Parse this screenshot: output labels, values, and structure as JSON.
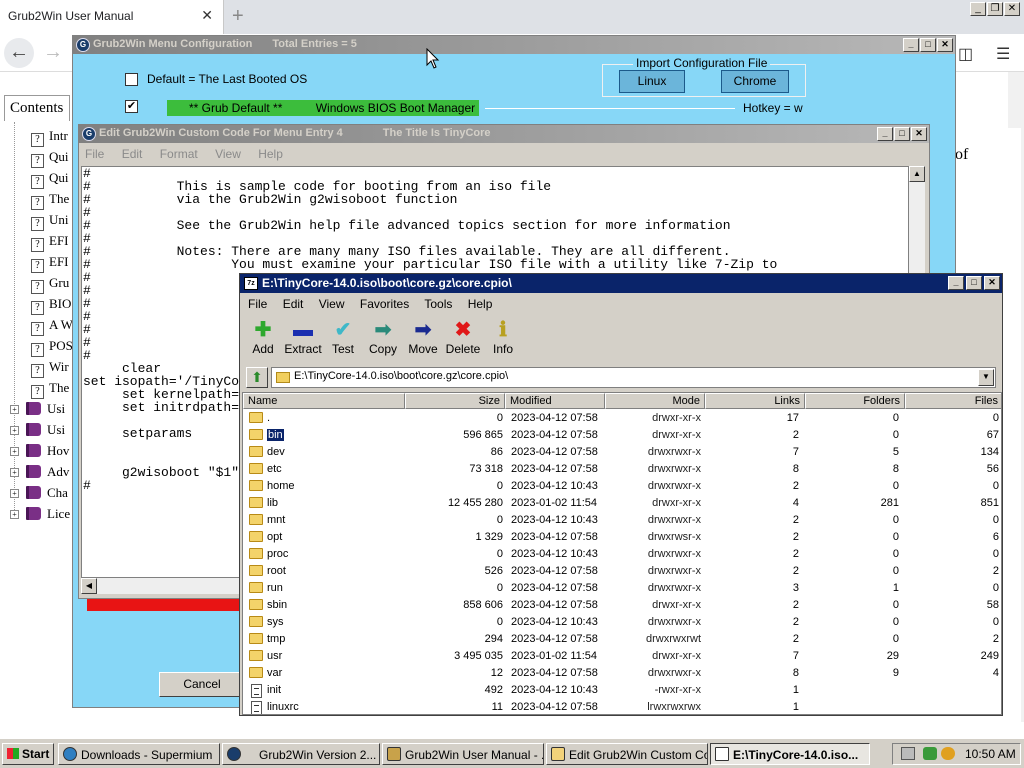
{
  "browser": {
    "tab_title": "Grub2Win User Manual",
    "tab_close": "✕",
    "new_tab": "+",
    "sys_buttons": [
      "_",
      "❐",
      "✕"
    ],
    "contents_tab": "Contents",
    "toc_items": [
      {
        "type": "page",
        "label": "Intr"
      },
      {
        "type": "page",
        "label": "Qui"
      },
      {
        "type": "page",
        "label": "Qui"
      },
      {
        "type": "page",
        "label": "The"
      },
      {
        "type": "page",
        "label": "Uni"
      },
      {
        "type": "page",
        "label": "EFI"
      },
      {
        "type": "page",
        "label": "EFI"
      },
      {
        "type": "page",
        "label": "Gru"
      },
      {
        "type": "page",
        "label": "BIO"
      },
      {
        "type": "page",
        "label": "A W"
      },
      {
        "type": "page",
        "label": "POS"
      },
      {
        "type": "page",
        "label": "Wir"
      },
      {
        "type": "page",
        "label": "The"
      },
      {
        "type": "book",
        "label": "Usi"
      },
      {
        "type": "book",
        "label": "Usi"
      },
      {
        "type": "book",
        "label": "Hov"
      },
      {
        "type": "book",
        "label": "Adv"
      },
      {
        "type": "book",
        "label": "Cha"
      },
      {
        "type": "book",
        "label": "Lice"
      }
    ],
    "right_text": "of"
  },
  "menu_config": {
    "title": "Grub2Win Menu Configuration",
    "total_entries": "Total Entries = 5",
    "default_label": "Default = The Last Booted OS",
    "default_checked": false,
    "entry_checked": true,
    "import_legend": "Import Configuration File",
    "import_buttons": [
      "Linux",
      "Chrome"
    ],
    "grub_default": "** Grub Default **",
    "entry_name": "Windows BIOS Boot Manager",
    "hotkey": "Hotkey = w",
    "cancel": "Cancel"
  },
  "edit_window": {
    "title": "Edit Grub2Win Custom Code For Menu Entry 4",
    "title_suffix": "The Title Is TinyCore",
    "menu": [
      "File",
      "Edit",
      "Format",
      "View",
      "Help"
    ],
    "code": "#\n#           This is sample code for booting from an iso file\n#           via the Grub2Win g2wisoboot function\n#\n#           See the Grub2Win help file advanced topics section for more information\n#\n#           Notes: There are many many ISO files available. They are all different.\n#                  You must examine your particular ISO file with a utility like 7-Zip to\n#\n#\n#\n#\n#\n#\n#\n     clear\nset isopath='/TinyCo\n     set kernelpath=\n     set initrdpath=\n\n     setparams\n\n\n     g2wisoboot \"$1\"\n#"
  },
  "zip_window": {
    "title": "E:\\TinyCore-14.0.iso\\boot\\core.gz\\core.cpio\\",
    "menu": [
      "File",
      "Edit",
      "View",
      "Favorites",
      "Tools",
      "Help"
    ],
    "toolbar": [
      {
        "label": "Add",
        "icon": "plus-icon",
        "glyph": "✚",
        "color": "#2ea82e"
      },
      {
        "label": "Extract",
        "icon": "minus-icon",
        "glyph": "▬",
        "color": "#1a2fb0"
      },
      {
        "label": "Test",
        "icon": "check-icon",
        "glyph": "✔",
        "color": "#3fb8c8"
      },
      {
        "label": "Copy",
        "icon": "copy-arrow-icon",
        "glyph": "➡",
        "color": "#2a8a7a"
      },
      {
        "label": "Move",
        "icon": "move-arrow-icon",
        "glyph": "➡",
        "color": "#1a2a90"
      },
      {
        "label": "Delete",
        "icon": "delete-x-icon",
        "glyph": "✖",
        "color": "#e01818"
      },
      {
        "label": "Info",
        "icon": "info-icon",
        "glyph": "ℹ",
        "color": "#b8a020"
      }
    ],
    "address": "E:\\TinyCore-14.0.iso\\boot\\core.gz\\core.cpio\\",
    "columns": [
      "Name",
      "Size",
      "Modified",
      "Mode",
      "Links",
      "Folders",
      "Files"
    ],
    "rows": [
      {
        "kind": "folder",
        "name": ".",
        "size": "0",
        "modified": "2023-04-12 07:58",
        "mode": "drwxr-xr-x",
        "links": "17",
        "folders": "0",
        "files": "0"
      },
      {
        "kind": "folder",
        "name": "bin",
        "size": "596 865",
        "modified": "2023-04-12 07:58",
        "mode": "drwxr-xr-x",
        "links": "2",
        "folders": "0",
        "files": "67",
        "selected": true
      },
      {
        "kind": "folder",
        "name": "dev",
        "size": "86",
        "modified": "2023-04-12 07:58",
        "mode": "drwxrwxr-x",
        "links": "7",
        "folders": "5",
        "files": "134"
      },
      {
        "kind": "folder",
        "name": "etc",
        "size": "73 318",
        "modified": "2023-04-12 07:58",
        "mode": "drwxrwxr-x",
        "links": "8",
        "folders": "8",
        "files": "56"
      },
      {
        "kind": "folder",
        "name": "home",
        "size": "0",
        "modified": "2023-04-12 10:43",
        "mode": "drwxrwxr-x",
        "links": "2",
        "folders": "0",
        "files": "0"
      },
      {
        "kind": "folder",
        "name": "lib",
        "size": "12 455 280",
        "modified": "2023-01-02 11:54",
        "mode": "drwxr-xr-x",
        "links": "4",
        "folders": "281",
        "files": "851"
      },
      {
        "kind": "folder",
        "name": "mnt",
        "size": "0",
        "modified": "2023-04-12 10:43",
        "mode": "drwxrwxr-x",
        "links": "2",
        "folders": "0",
        "files": "0"
      },
      {
        "kind": "folder",
        "name": "opt",
        "size": "1 329",
        "modified": "2023-04-12 07:58",
        "mode": "drwxrwsr-x",
        "links": "2",
        "folders": "0",
        "files": "6"
      },
      {
        "kind": "folder",
        "name": "proc",
        "size": "0",
        "modified": "2023-04-12 10:43",
        "mode": "drwxrwxr-x",
        "links": "2",
        "folders": "0",
        "files": "0"
      },
      {
        "kind": "folder",
        "name": "root",
        "size": "526",
        "modified": "2023-04-12 07:58",
        "mode": "drwxrwxr-x",
        "links": "2",
        "folders": "0",
        "files": "2"
      },
      {
        "kind": "folder",
        "name": "run",
        "size": "0",
        "modified": "2023-04-12 07:58",
        "mode": "drwxrwxr-x",
        "links": "3",
        "folders": "1",
        "files": "0"
      },
      {
        "kind": "folder",
        "name": "sbin",
        "size": "858 606",
        "modified": "2023-04-12 07:58",
        "mode": "drwxr-xr-x",
        "links": "2",
        "folders": "0",
        "files": "58"
      },
      {
        "kind": "folder",
        "name": "sys",
        "size": "0",
        "modified": "2023-04-12 10:43",
        "mode": "drwxrwxr-x",
        "links": "2",
        "folders": "0",
        "files": "0"
      },
      {
        "kind": "folder",
        "name": "tmp",
        "size": "294",
        "modified": "2023-04-12 07:58",
        "mode": "drwxrwxrwt",
        "links": "2",
        "folders": "0",
        "files": "2"
      },
      {
        "kind": "folder",
        "name": "usr",
        "size": "3 495 035",
        "modified": "2023-01-02 11:54",
        "mode": "drwxr-xr-x",
        "links": "7",
        "folders": "29",
        "files": "249"
      },
      {
        "kind": "folder",
        "name": "var",
        "size": "12",
        "modified": "2023-04-12 07:58",
        "mode": "drwxrwxr-x",
        "links": "8",
        "folders": "9",
        "files": "4"
      },
      {
        "kind": "file",
        "name": "init",
        "size": "492",
        "modified": "2023-04-12 10:43",
        "mode": "-rwxr-xr-x",
        "links": "1",
        "folders": "",
        "files": ""
      },
      {
        "kind": "file",
        "name": "linuxrc",
        "size": "11",
        "modified": "2023-04-12 07:58",
        "mode": "lrwxrwxrwx",
        "links": "1",
        "folders": "",
        "files": ""
      }
    ]
  },
  "taskbar": {
    "start": "Start",
    "tasks": [
      {
        "label": "Downloads - Supermium",
        "active": false
      },
      {
        "label": "Grub2Win   Version 2...",
        "active": false
      },
      {
        "label": "Grub2Win User Manual - ...",
        "active": false
      },
      {
        "label": "Edit Grub2Win Custom Co...",
        "active": false
      },
      {
        "label": "E:\\TinyCore-14.0.iso...",
        "active": true
      }
    ],
    "clock": "10:50 AM"
  }
}
